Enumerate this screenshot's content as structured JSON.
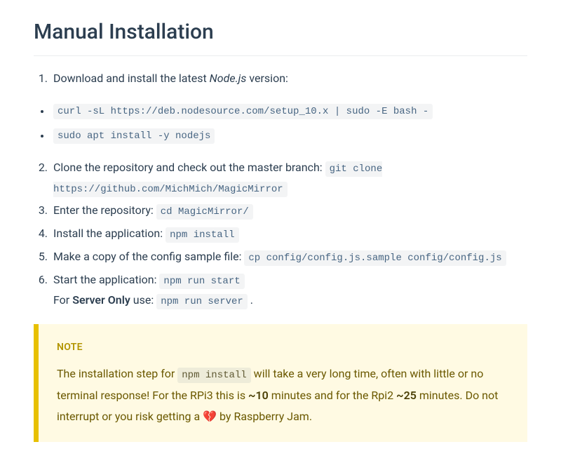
{
  "heading": "Manual Installation",
  "list1": {
    "item1_prefix": "Download and install the latest ",
    "item1_em": "Node.js",
    "item1_suffix": " version:"
  },
  "commands": {
    "curl": "curl -sL https://deb.nodesource.com/setup_10.x | sudo -E bash -",
    "apt": "sudo apt install -y nodejs"
  },
  "list2": {
    "item2_prefix": "Clone the repository and check out the master branch: ",
    "item2_code": "git clone https://github.com/MichMich/MagicMirror",
    "item3_prefix": "Enter the repository: ",
    "item3_code": "cd MagicMirror/",
    "item4_prefix": "Install the application: ",
    "item4_code": "npm install",
    "item5_prefix": "Make a copy of the config sample file: ",
    "item5_code": "cp config/config.js.sample config/config.js",
    "item6_prefix": "Start the application: ",
    "item6_code": "npm run start",
    "item6_for": "For ",
    "item6_strong": "Server Only",
    "item6_use": " use: ",
    "item6_code2": "npm run server",
    "item6_period": " ."
  },
  "note": {
    "title": "NOTE",
    "p1": "The installation step for ",
    "code1": "npm install",
    "p2": " will take a very long time, often with little or no terminal response! For the RPi3 this is ",
    "b1": "~10",
    "p3": " minutes and for the Rpi2 ",
    "b2": "~25",
    "p4": " minutes. Do not interrupt or you risk getting a ",
    "heart": "💔",
    "p5": " by Raspberry Jam."
  }
}
